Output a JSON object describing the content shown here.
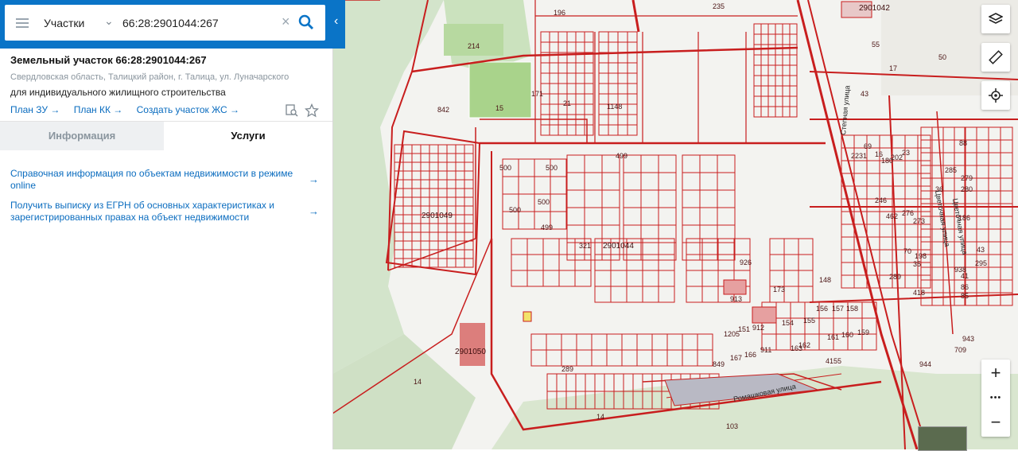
{
  "search": {
    "type_label": "Участки",
    "query": "66:28:2901044:267"
  },
  "parcel": {
    "title": "Земельный участок 66:28:2901044:267",
    "address": "Свердловская область, Талицкий район, г. Талица, ул. Луначарского",
    "usage": "для индивидуального жилищного строительства",
    "links": [
      "План ЗУ →",
      "План КК →",
      "Создать участок ЖС →"
    ]
  },
  "tabs": {
    "info": "Информация",
    "services": "Услуги"
  },
  "services": [
    {
      "text": "Справочная информация по объектам недвижимости в режиме online",
      "arrow": "→"
    },
    {
      "text": "Получить выписку из ЕГРН об основных характеристиках и зарегистрированных правах на объект недвижимости",
      "arrow": "→"
    }
  ],
  "map": {
    "labels": [
      "196",
      "235",
      "2901042",
      "55",
      "17",
      "50",
      "214",
      "171",
      "842",
      "15",
      "21",
      "1148",
      "43",
      "499",
      "500",
      "500",
      "500",
      "500",
      "321",
      "2901044",
      "926",
      "173",
      "148",
      "913",
      "1205",
      "151",
      "912",
      "154",
      "155",
      "156",
      "157",
      "158",
      "160",
      "161",
      "159",
      "911",
      "163",
      "162",
      "166",
      "167",
      "849",
      "289",
      "4155",
      "14",
      "103",
      "14",
      "2901049",
      "2901050",
      "69",
      "16",
      "180",
      "202",
      "23",
      "88",
      "285",
      "279",
      "2231",
      "280",
      "36",
      "246",
      "462",
      "276",
      "273",
      "186",
      "70",
      "35",
      "198",
      "41",
      "86",
      "85",
      "43",
      "295",
      "289",
      "938",
      "418",
      "943",
      "709",
      "944",
      "499"
    ],
    "streets": [
      "Степная улица",
      "Цветочная улица",
      "Цветочная улица",
      "Ромашковая улица"
    ],
    "colors": {
      "boundary": "#c81e1e",
      "highlight": "#f3e36a",
      "field": "#a9d38b",
      "forest": "#d4e5cc"
    }
  },
  "controls": {
    "layers": "layers-icon",
    "ruler": "ruler-icon",
    "locate": "locate-icon",
    "zoom_in": "+",
    "zoom_more": "•••",
    "zoom_out": "−"
  }
}
